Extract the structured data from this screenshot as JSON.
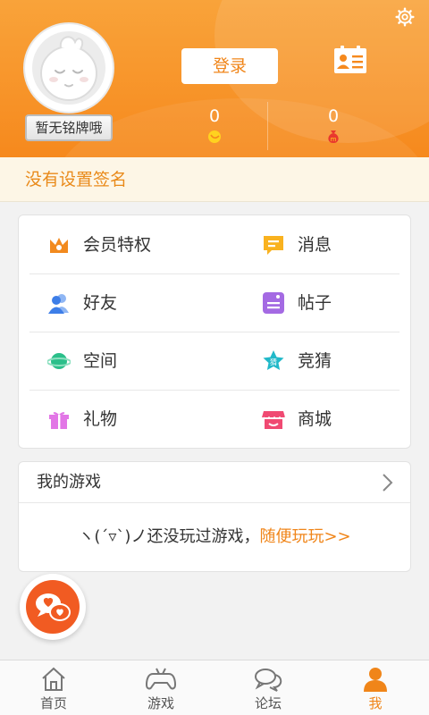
{
  "header": {
    "badge_text": "暂无铭牌哦",
    "login_label": "登录",
    "stat_coins": "0",
    "stat_money": "0",
    "colors": {
      "accent": "#f6891d",
      "accent_light": "#f9a33a"
    }
  },
  "signature": {
    "text": "没有设置签名"
  },
  "menu": {
    "items": [
      {
        "label": "会员特权",
        "icon": "crown-icon",
        "color": "#f28a1e"
      },
      {
        "label": "消息",
        "icon": "message-icon",
        "color": "#f9b21f"
      },
      {
        "label": "好友",
        "icon": "friends-icon",
        "color": "#3d7ee8"
      },
      {
        "label": "帖子",
        "icon": "post-icon",
        "color": "#a46ae3"
      },
      {
        "label": "空间",
        "icon": "planet-icon",
        "color": "#2bbf8a"
      },
      {
        "label": "竞猜",
        "icon": "guess-star-icon",
        "color": "#21b9c9",
        "glyph": "猜"
      },
      {
        "label": "礼物",
        "icon": "gift-icon",
        "color": "#e276e6"
      },
      {
        "label": "商城",
        "icon": "store-icon",
        "color": "#f04a72"
      }
    ]
  },
  "games": {
    "title": "我的游戏",
    "empty_text": "ヽ(ˊ▿ˋ)ノ还没玩过游戏，",
    "empty_link": "随便玩玩>>"
  },
  "tabbar": {
    "tabs": [
      {
        "label": "首页",
        "icon": "home-icon"
      },
      {
        "label": "游戏",
        "icon": "gamepad-icon"
      },
      {
        "label": "论坛",
        "icon": "forum-icon"
      },
      {
        "label": "我",
        "icon": "user-icon",
        "active": true
      }
    ]
  }
}
